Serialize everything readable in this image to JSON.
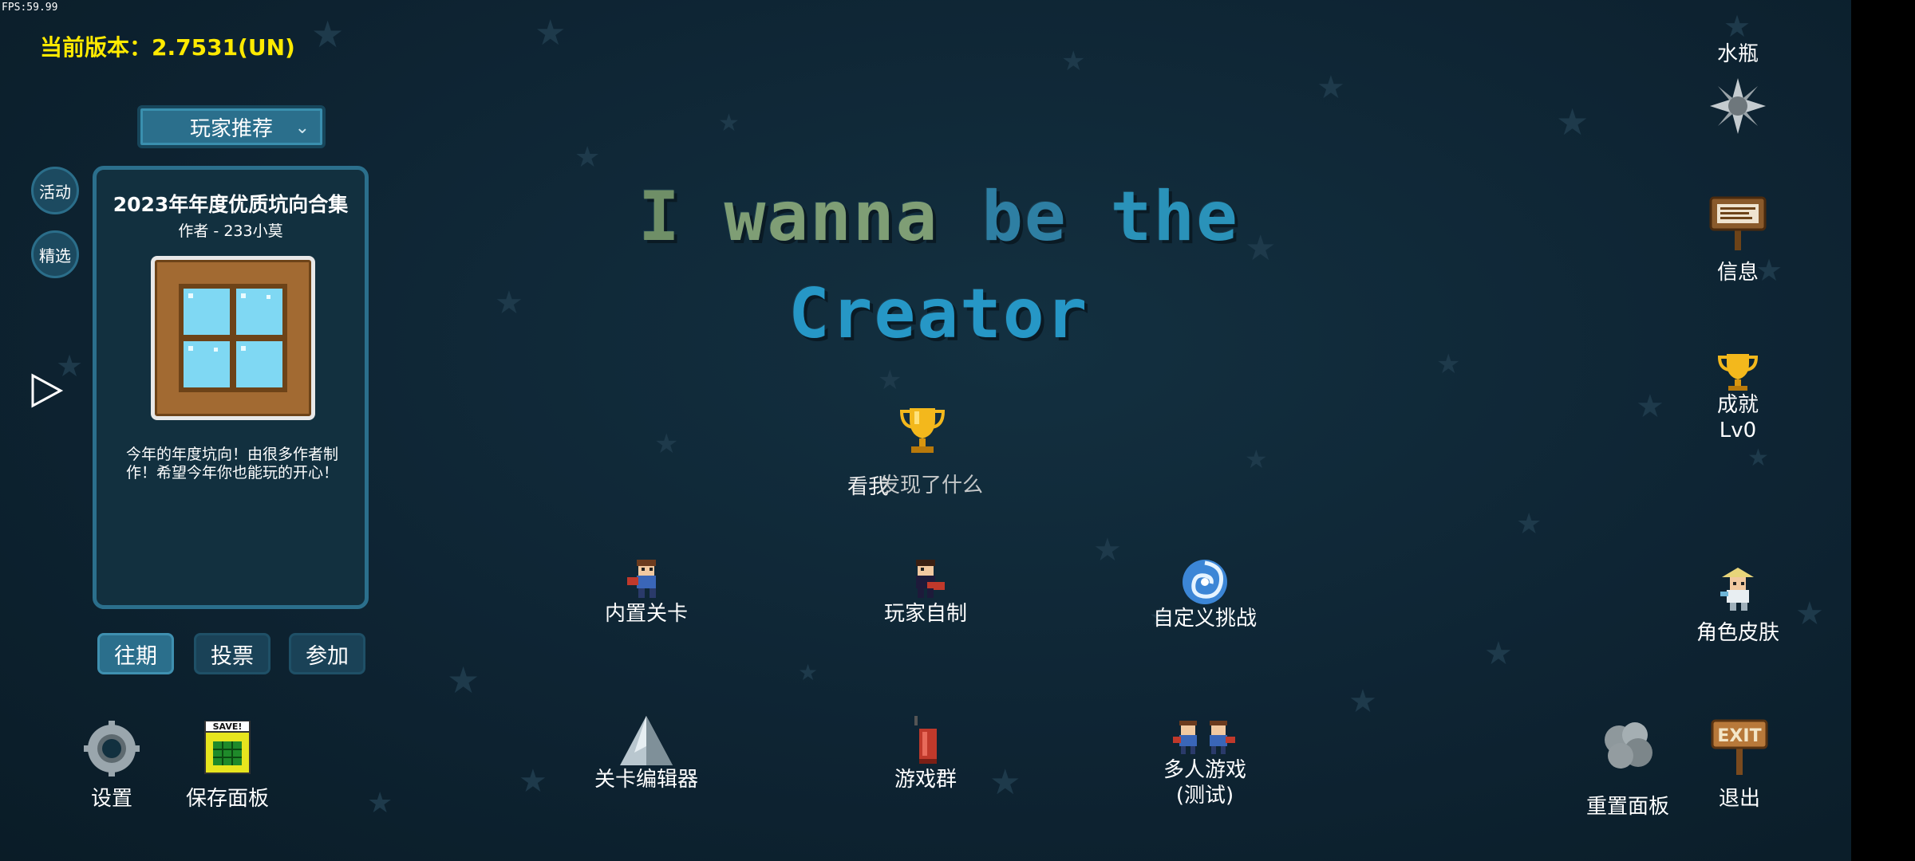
{
  "hud": {
    "fps": "FPS:59.99",
    "version": "当前版本：2.7531(UN)"
  },
  "sidebar": {
    "dropdown_label": "玩家推荐",
    "activity_label": "活动",
    "featured_label": "精选"
  },
  "card": {
    "title": "2023年年度优质坑向合集",
    "author": "作者 - 233小莫",
    "description": "今年的年度坑向！由很多作者制作！希望今年你也能玩的开心！"
  },
  "tabs": {
    "past": "往期",
    "vote": "投票",
    "join": "参加"
  },
  "title": {
    "word1": "I",
    "word2": "wanna",
    "word3": "be",
    "word4": "the",
    "line2": "Creator"
  },
  "center": {
    "text_a": "看我",
    "text_b": "发现了什么"
  },
  "menu": {
    "builtin": "内置关卡",
    "player_made": "玩家自制",
    "custom_challenge": "自定义挑战",
    "editor": "关卡编辑器",
    "group": "游戏群",
    "multiplayer_line1": "多人游戏",
    "multiplayer_line2": "(测试)"
  },
  "bottom": {
    "settings": "设置",
    "save_panel": "保存面板",
    "reset_panel": "重置面板",
    "exit": "退出",
    "save_sign": "SAVE!",
    "exit_sign": "EXIT"
  },
  "right": {
    "bottle": "水瓶",
    "info": "信息",
    "achievement": "成就",
    "level": "Lv0",
    "skin": "角色皮肤"
  },
  "colors": {
    "version": "#ffea00",
    "accent": "#2b6f8c",
    "background": "#0e2433"
  }
}
